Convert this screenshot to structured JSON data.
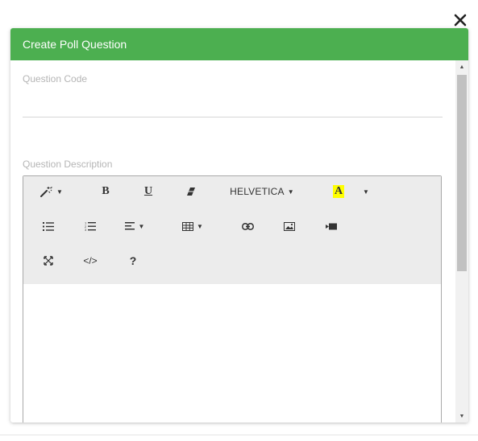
{
  "modal": {
    "title": "Create Poll Question",
    "header_color": "#4caf50",
    "close_icon": "close-icon"
  },
  "form": {
    "question_code": {
      "label": "Question Code",
      "value": ""
    },
    "question_description": {
      "label": "Question Description",
      "value": ""
    }
  },
  "editor": {
    "toolbar": {
      "row1": {
        "style_icon": "magic-wand-icon",
        "bold_label": "B",
        "underline_label": "U",
        "clear_format_icon": "eraser-icon",
        "font_name": "HELVETICA",
        "color_label": "A",
        "color_highlight": "#ffff00"
      },
      "row2": {
        "unordered_list_icon": "unordered-list-icon",
        "ordered_list_icon": "ordered-list-icon",
        "paragraph_icon": "align-left-icon",
        "table_icon": "table-icon",
        "link_icon": "link-icon",
        "picture_icon": "picture-icon",
        "video_icon": "video-icon"
      },
      "row3": {
        "fullscreen_icon": "fullscreen-icon",
        "codeview_label": "</>",
        "help_label": "?"
      }
    },
    "content": ""
  },
  "scrollbar": {
    "up_arrow": "▲",
    "down_arrow": "▼"
  }
}
